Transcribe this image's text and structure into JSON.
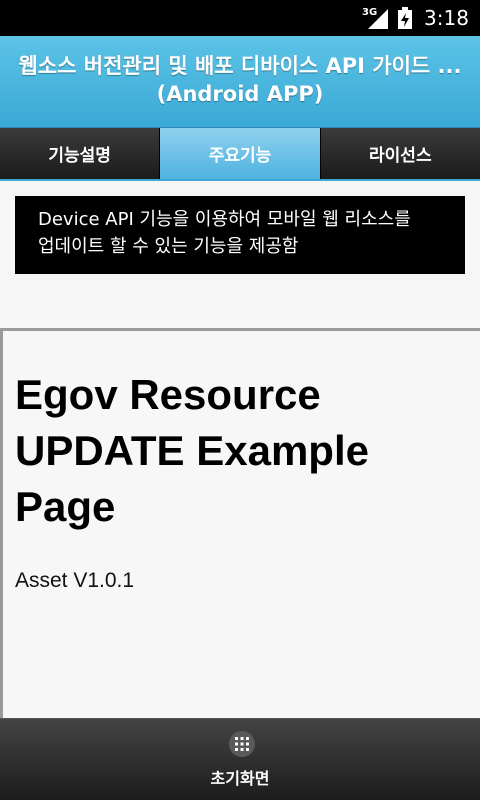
{
  "status_bar": {
    "network": "3G",
    "time": "3:18"
  },
  "header": {
    "title_line1": "웹소스 버전관리 및 배포 디바이스 API 가이드 ...",
    "title_line2": "(Android APP)"
  },
  "tabs": [
    {
      "label": "기능설명",
      "active": false
    },
    {
      "label": "주요기능",
      "active": true
    },
    {
      "label": "라이선스",
      "active": false
    }
  ],
  "description": {
    "line1": "Device API 기능을 이용하여 모바일 웹 리소스를",
    "line2": "업데이트 할 수 있는 기능을 제공함"
  },
  "content": {
    "heading": "Egov Resource UPDATE Example Page",
    "version": "Asset V1.0.1"
  },
  "footer": {
    "home_label": "초기화면",
    "icon": "grid-icon"
  }
}
